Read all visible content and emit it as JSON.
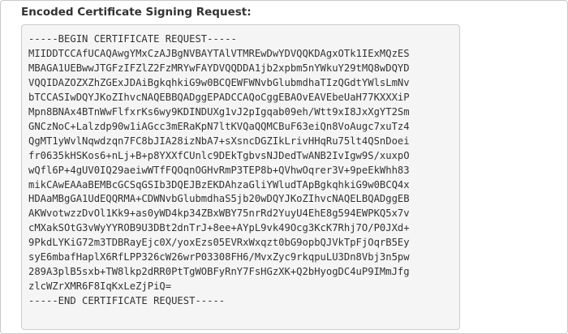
{
  "field": {
    "label": "Encoded Certificate Signing Request:"
  },
  "csr": {
    "lines": [
      "-----BEGIN CERTIFICATE REQUEST-----",
      "MIIDDTCCAfUCAQAwgYMxCzAJBgNVBAYTAlVTMREwDwYDVQQKDAgxOTk1IExMQzES",
      "MBAGA1UEBwwJTGFzIFZlZ2FzMRYwFAYDVQQDDA1jb2xpbm5nYWkuY29tMQ8wDQYD",
      "VQQIDAZOZXZhZGExJDAiBgkqhkiG9w0BCQEWFWNvbGlubmdhaTIzQGdtYWlsLmNv",
      "bTCCASIwDQYJKoZIhvcNAQEBBQADggEPADCCAQoCggEBAOvEAVEbeUaH77KXXXiP",
      "Mpn8BNAx4BTnWwFlfxrKs6wy9KDINDUXg1vJ2pIgqab09eh/Wtt9xI8JxXgYT2Sm",
      "GNCzNoC+Lalzdp90w1iAGcc3mERaKpN7ltKVQaQQMCBuF63eiQn8VoAugc7xuTz4",
      "QgMT1yWvlNqwdzqn7FC8bJIA28izNbA7+sXsncDGZIkLrivHHqRu75lt4QSnDoei",
      "fr0635kHSKos6+nLj+B+p8YXXfCUnlc9DEkTgbvsNJDedTwANB2IvIgw9S/xuxpO",
      "wQfl6P+4gUV0IQ29aeiwWTfFQOqnOGHvRmP3TEP8b+QVhwOqrer3V+9peEkWhh83",
      "mikCAwEAAaBEMBcGCSqGSIb3DQEJBzEKDAhzaGliYWludTApBgkqhkiG9w0BCQ4x",
      "HDAaMBgGA1UdEQQRMA+CDWNvbGlubmdhaS5jb20wDQYJKoZIhvcNAQELBQADggEB",
      "AKWvotwzzDvOl1Kk9+as0yWD4kp34ZBxWBY75nrRd2YuyU4EhE8g594EWPKQ5x7v",
      "cMXakSOtG3vWyYYROB9U3DBt2dnTrJ+8ee+AYpL9vk49Ocg3KcK7Rhj7O/P0JXd+",
      "9PkdLYKiG72m3TDBRayEjc0X/yoxEzs05EVRxWxqzt0bG9opbQJVkTpFjOqrB5Ey",
      "syE6mbafHaplX6RfLPP326cW26wrP03308FH6/MvxZyc9rkqpuLU3Dn8Vbj3n5pw",
      "289A3plB5sxb+TW8lkp2dRR0PtTgWOBFyRnY7FsHGzXK+Q2bHyogDC4uP9IMmJfg",
      "zlcWZrXMR6F8IqKxLeZjPiQ=",
      "-----END CERTIFICATE REQUEST-----"
    ]
  }
}
